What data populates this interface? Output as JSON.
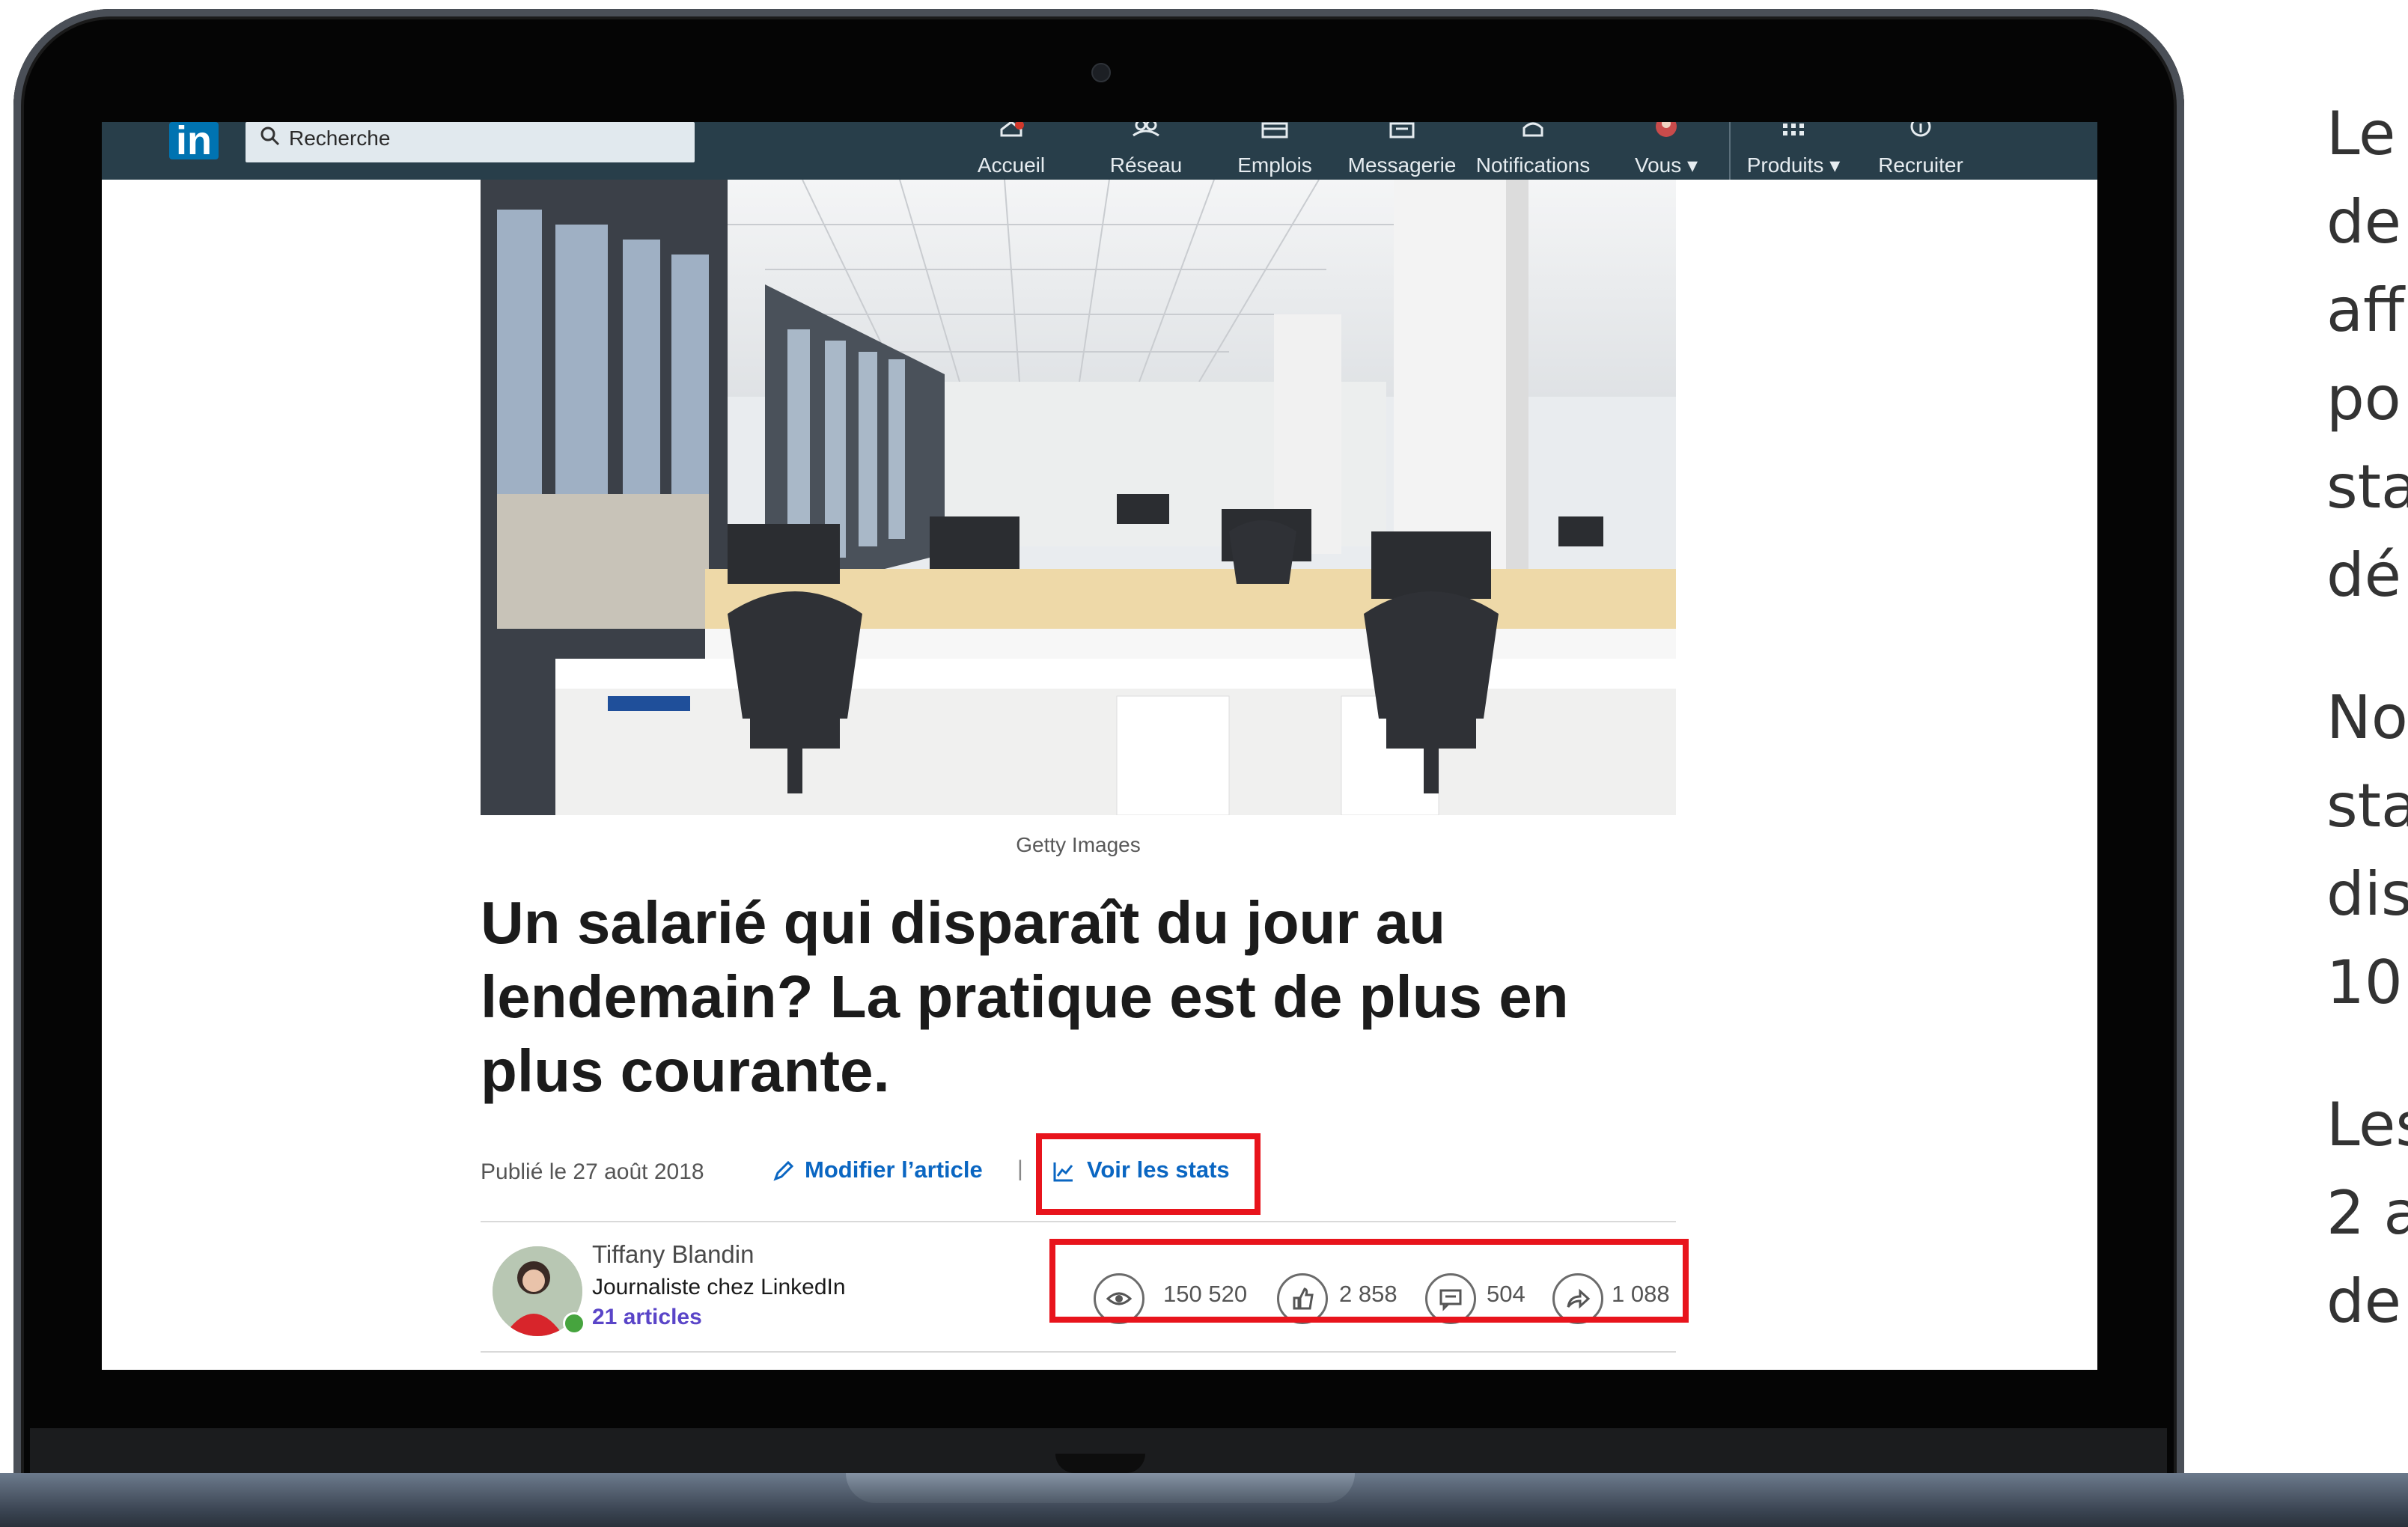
{
  "linkedin": {
    "logo": "in",
    "search_placeholder": "Recherche",
    "nav": [
      {
        "label": "Accueil",
        "icon": "home-icon"
      },
      {
        "label": "Réseau",
        "icon": "network-icon"
      },
      {
        "label": "Emplois",
        "icon": "jobs-icon"
      },
      {
        "label": "Messagerie",
        "icon": "messaging-icon"
      },
      {
        "label": "Notifications",
        "icon": "bell-icon"
      },
      {
        "label": "Vous ▾",
        "icon": "avatar"
      },
      {
        "label": "Produits ▾",
        "icon": "grid-icon"
      },
      {
        "label": "Recruiter",
        "icon": "recruiter-icon"
      }
    ]
  },
  "article": {
    "image_credit": "Getty Images",
    "title": "Un salarié qui disparaît du jour au lendemain? La pratique est de plus en plus courante.",
    "published": "Publié le 27 août 2018",
    "edit_label": "Modifier l’article",
    "separator": "|",
    "stats_label": "Voir les stats"
  },
  "author": {
    "name": "Tiffany Blandin",
    "role": "Journaliste chez LinkedIn",
    "articles": "21 articles"
  },
  "stats": {
    "views": "150 520",
    "likes": "2 858",
    "comments": "504",
    "shares": "1 088"
  },
  "colors": {
    "navbar": "#283e4a",
    "link_blue": "#0a66c2",
    "highlight_red": "#e8141c"
  },
  "side_text": [
    "Le",
    "de",
    "aff",
    "po",
    "sta",
    "dé",
    "No",
    "sta",
    "dis",
    "10",
    "Les",
    "2 a",
    "de"
  ]
}
